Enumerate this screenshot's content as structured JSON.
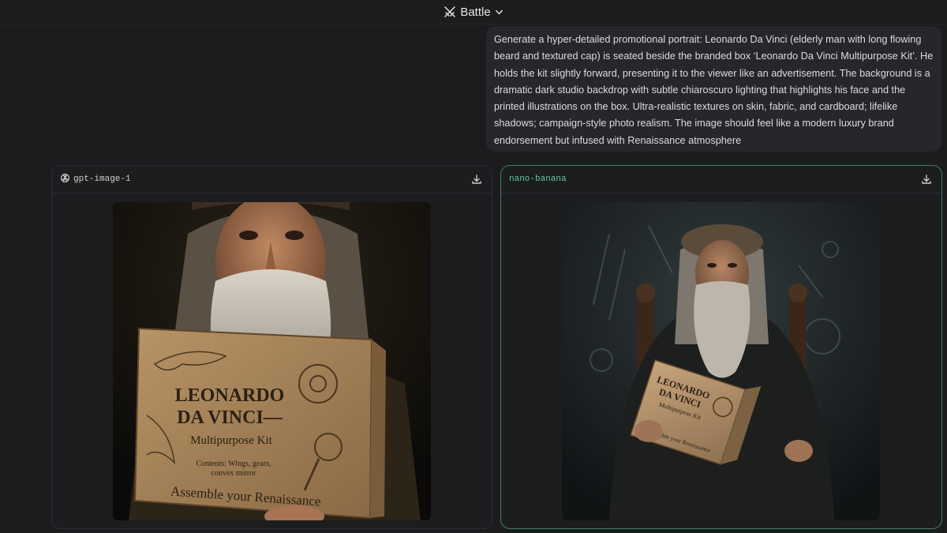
{
  "topbar": {
    "mode_label": "Battle",
    "mode_icon": "crossed-swords-icon",
    "dropdown_icon": "chevron-down-icon"
  },
  "prompt": {
    "text": "Generate a hyper-detailed promotional portrait: Leonardo Da Vinci (elderly man with long flowing beard and textured cap) is seated beside the branded box ‘Leonardo Da Vinci Multipurpose Kit’. He holds the kit slightly forward, presenting it to the viewer like an advertisement. The background is a dramatic dark studio backdrop with subtle chiaroscuro lighting that highlights his face and the printed illustrations on the box. Ultra-realistic textures on skin, fabric, and cardboard; lifelike shadows; campaign-style photo realism. The image should feel like a modern luxury brand endorsement but infused with Renaissance atmosphere"
  },
  "panels": [
    {
      "model": "gpt-image-1",
      "model_icon": "openai-logo-icon",
      "download_icon": "download-icon",
      "box_text": {
        "line1": "LEONARDO",
        "line2": "DA VINCI—",
        "line3": "Multipurpose Kit",
        "line4": "Contents: Wings, gears,",
        "line5": "convex mirror",
        "line6": "Assemble your Renaissance"
      }
    },
    {
      "model": "nano-banana",
      "download_icon": "download-icon",
      "box_text": {
        "line1": "LEONARDO",
        "line2": "DA VINCI",
        "line3": "Multipurpose Kit",
        "line6": "Assemble your Renaissance"
      }
    }
  ],
  "colors": {
    "background": "#1b1c1e",
    "prompt_bubble": "#26272a",
    "selected_border": "#3f7a66",
    "selected_model_text": "#5fc79a"
  }
}
